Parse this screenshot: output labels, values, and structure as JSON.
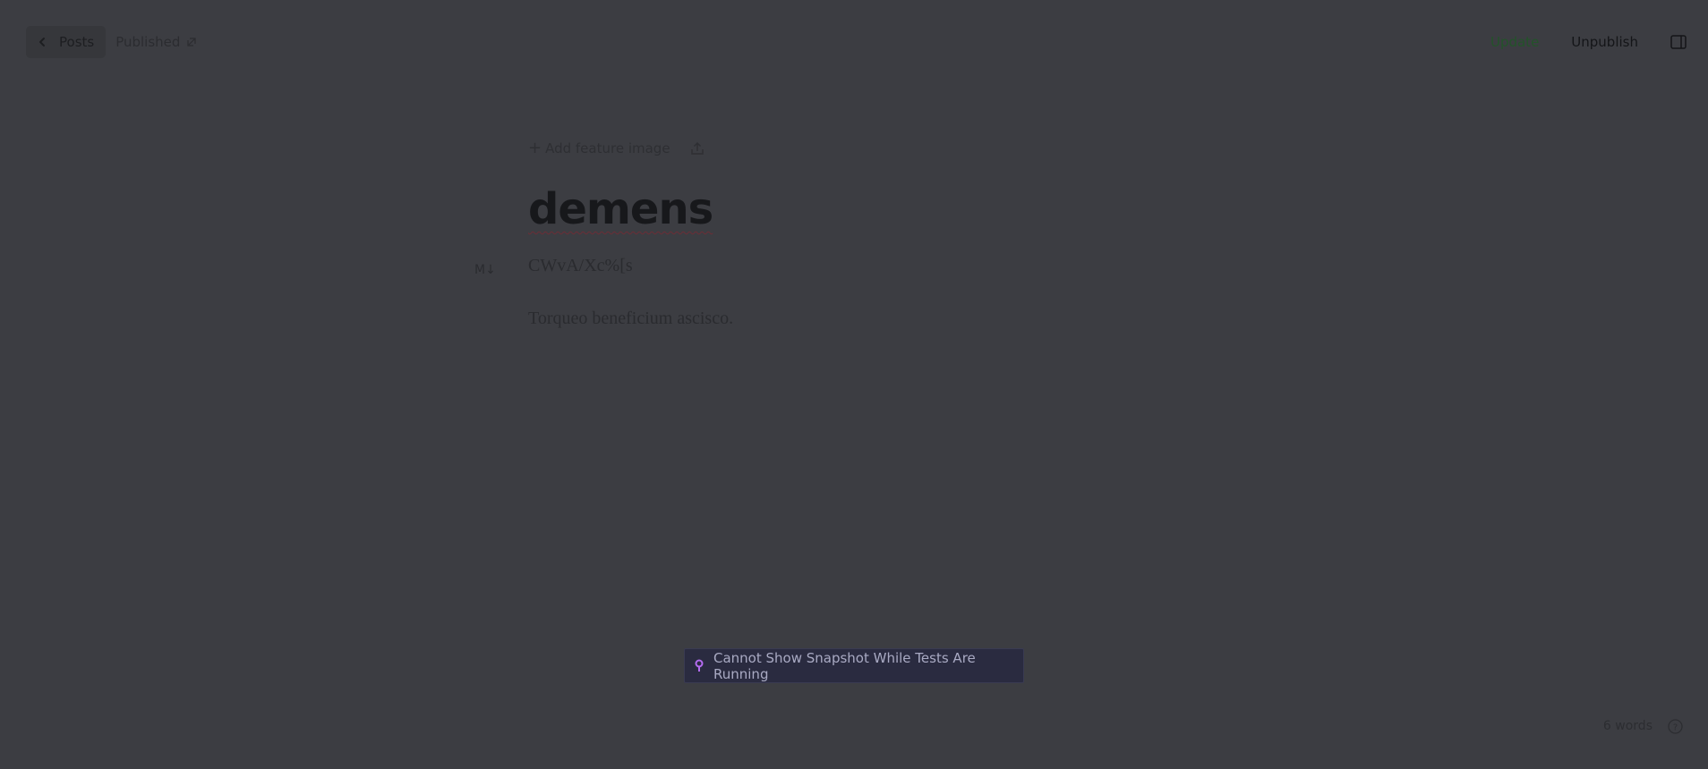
{
  "header": {
    "back_label": "Posts",
    "status": "Published",
    "update_label": "Update",
    "unpublish_label": "Unpublish"
  },
  "editor": {
    "add_feature_image": "Add feature image",
    "title": "demens",
    "markdown_marker": "M↓",
    "paragraphs": [
      "CWvA/Xc%[s",
      "Torqueo beneficium ascisco."
    ]
  },
  "toast": {
    "message": "Cannot Show Snapshot While Tests Are Running"
  },
  "footer": {
    "word_count": "6 words"
  },
  "colors": {
    "background": "#3c3d42",
    "update_accent": "#23532a",
    "toast_background": "#2a2b40",
    "toast_icon": "#b46cf0"
  },
  "icons": {
    "back": "chevron-left-icon",
    "status_link": "external-link-icon",
    "sidebar": "sidebar-toggle-icon",
    "upload": "upload-image-icon",
    "toast": "pin-icon",
    "help": "help-circle-icon"
  }
}
